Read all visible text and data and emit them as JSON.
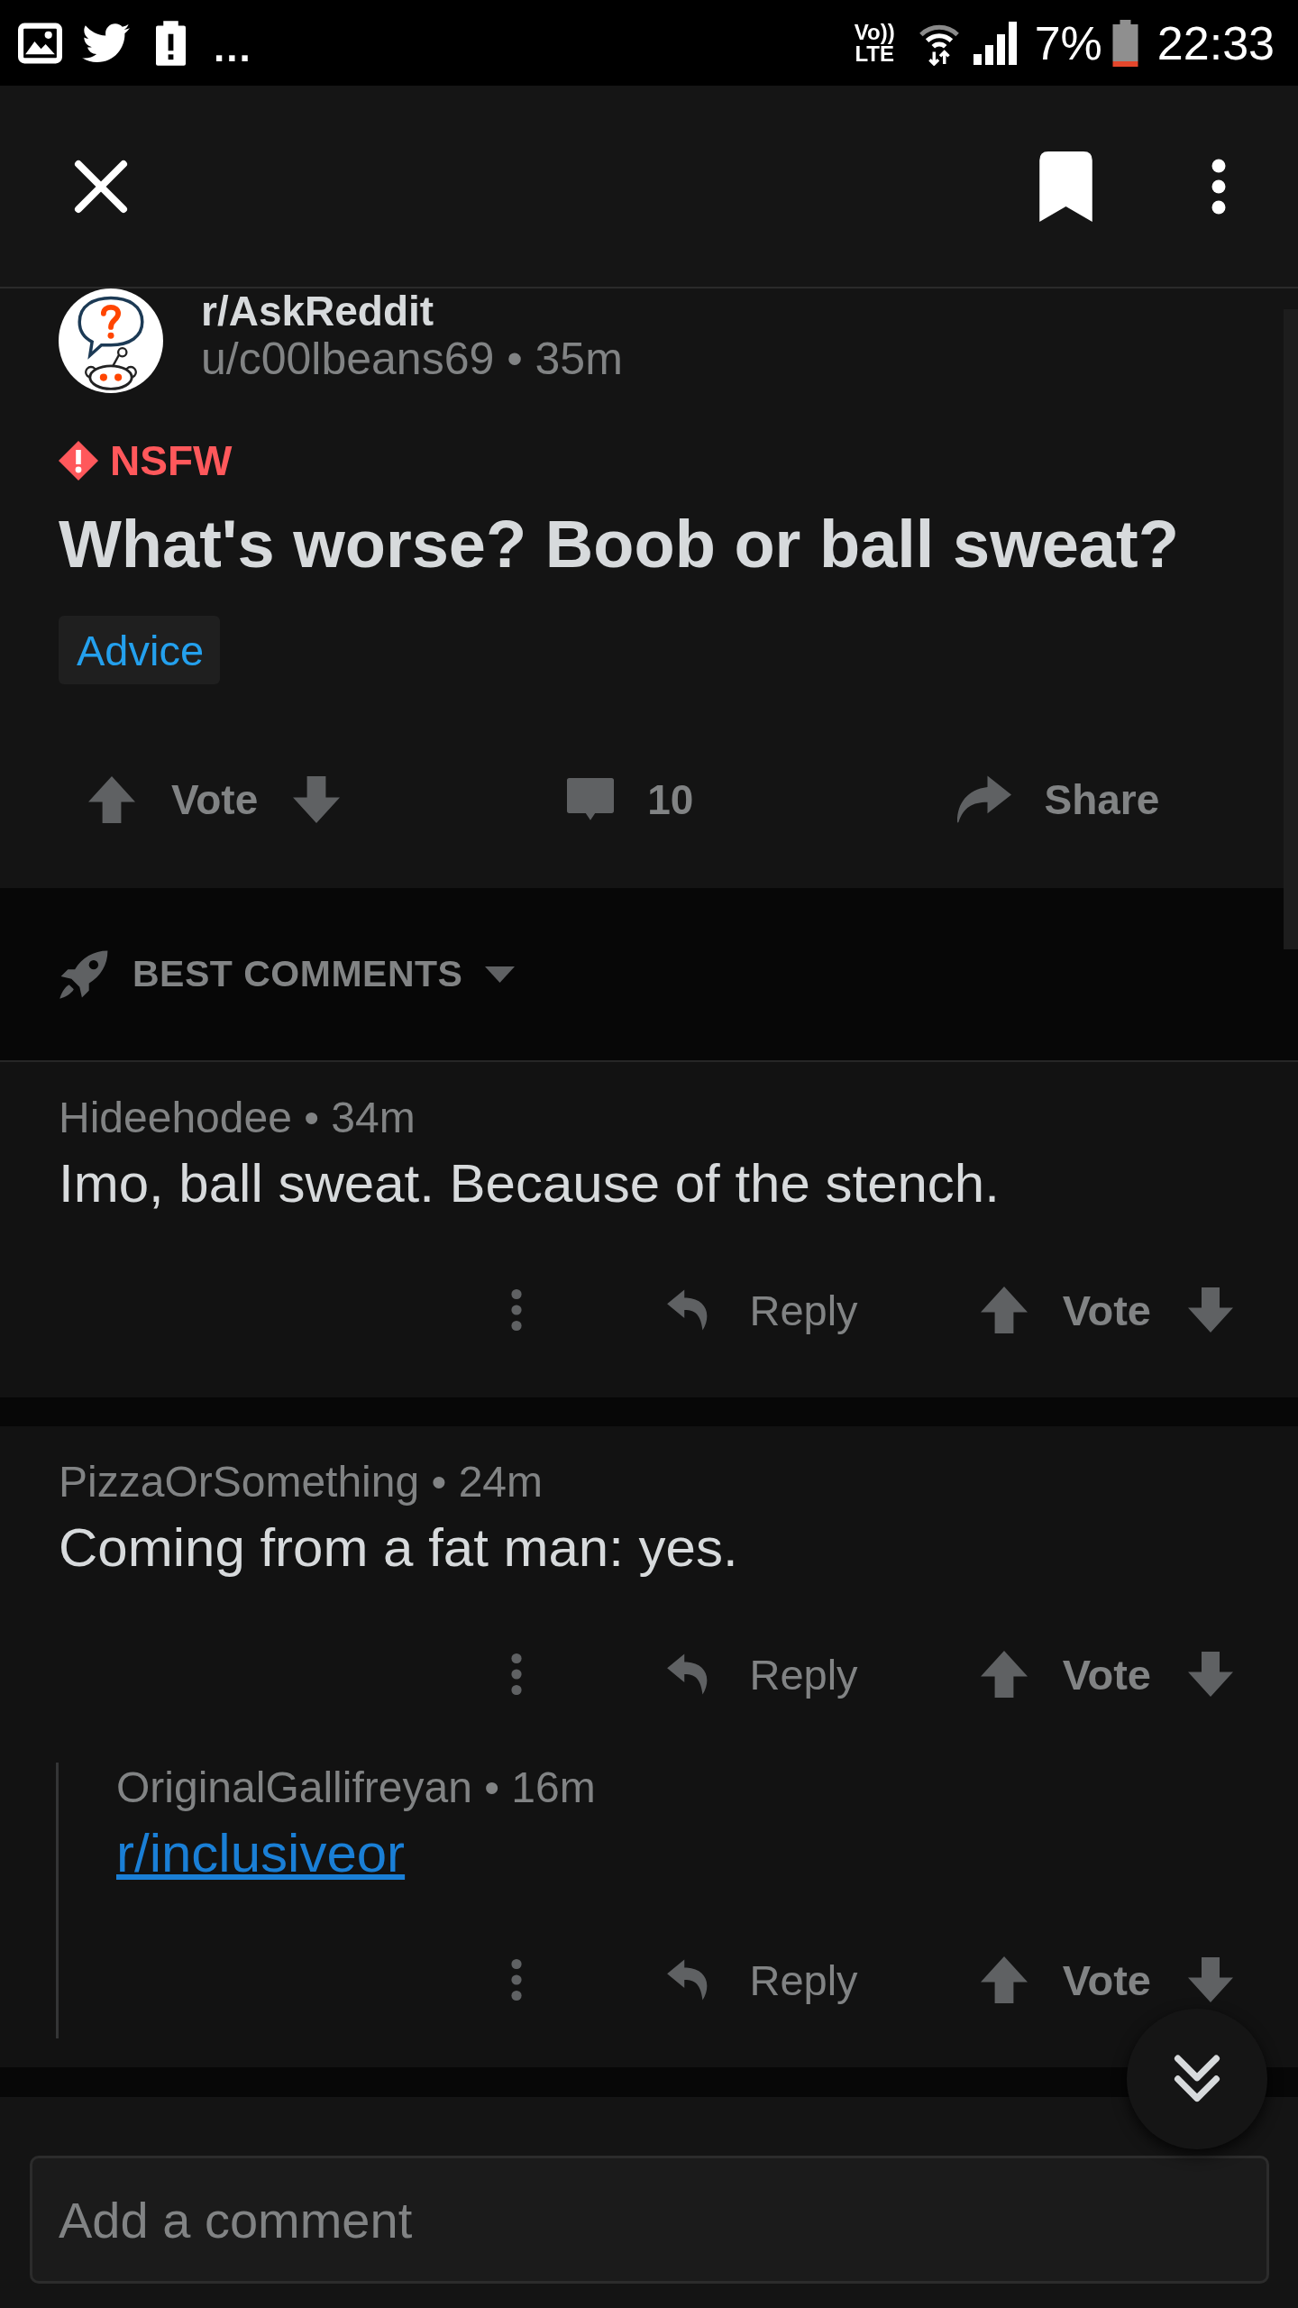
{
  "status_bar": {
    "overflow": "...",
    "network_top": "Vo))",
    "network_bottom": "LTE",
    "battery": "7%",
    "time": "22:33"
  },
  "post": {
    "subreddit": "r/AskReddit",
    "byline": "u/c00lbeans69 • 35m",
    "nsfw": "NSFW",
    "title": "What's worse? Boob or ball sweat?",
    "flair": "Advice",
    "vote_label": "Vote",
    "comment_count": "10",
    "share_label": "Share"
  },
  "sort": {
    "label": "BEST COMMENTS"
  },
  "comments": [
    {
      "kind": "text",
      "byline": "Hideehodee • 34m",
      "body": "Imo, ball sweat. Because of the stench.",
      "reply_label": "Reply",
      "vote_label": "Vote"
    },
    {
      "kind": "text",
      "byline": "PizzaOrSomething • 24m",
      "body": "Coming from a fat man: yes.",
      "reply_label": "Reply",
      "vote_label": "Vote",
      "children": [
        {
          "kind": "link",
          "byline": "OriginalGallifreyan • 16m",
          "body": "r/inclusiveor",
          "reply_label": "Reply",
          "vote_label": "Vote"
        }
      ]
    }
  ],
  "comment_box": {
    "placeholder": "Add a comment"
  }
}
